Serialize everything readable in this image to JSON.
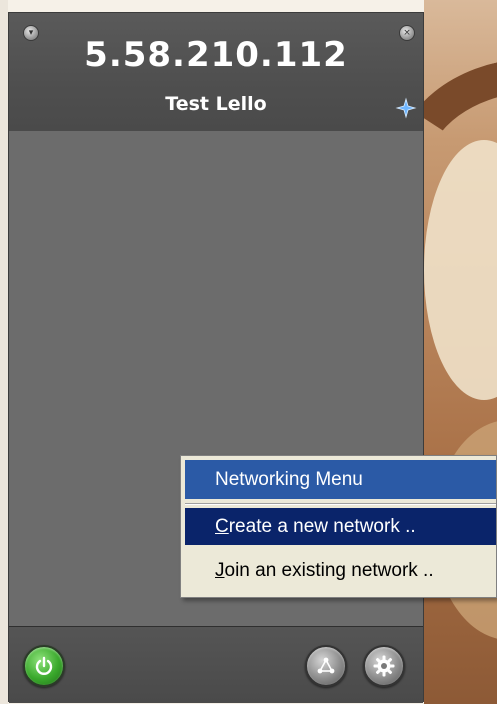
{
  "window": {
    "ip_address": "5.58.210.112",
    "network_name": "Test Lello"
  },
  "menu": {
    "title": "Networking Menu",
    "items": [
      {
        "mnemonic": "C",
        "rest": "reate a new network ..",
        "selected": true
      },
      {
        "mnemonic": "J",
        "rest": "oin an existing network ..",
        "selected": false
      }
    ]
  },
  "icons": {
    "collapse": "chevron-down-icon",
    "close": "close-icon",
    "pin": "pin-icon",
    "power": "power-icon",
    "network": "network-icon",
    "settings": "gear-icon"
  },
  "colors": {
    "menu_title_bg": "#2b5aa6",
    "menu_selected_bg": "#0a246a",
    "power_green": "#3aa92c",
    "window_gray": "#6a6a6a"
  }
}
